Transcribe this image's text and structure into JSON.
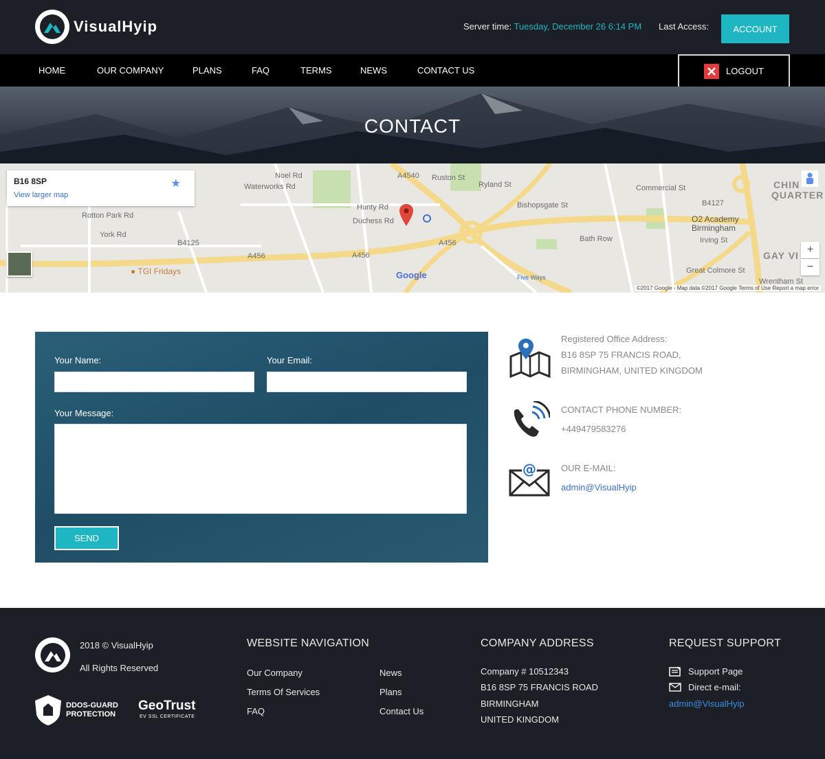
{
  "header": {
    "brand": "VisualHyip",
    "server_label": "Server time:",
    "server_time": "Tuesday, December 26 6:14 PM",
    "last_access_label": "Last Access:",
    "account_label": "ACCOUNT",
    "accent_color": "#1fb6c4"
  },
  "nav": {
    "items": [
      "HOME",
      "OUR COMPANY",
      "PLANS",
      "FAQ",
      "TERMS",
      "NEWS",
      "CONTACT US"
    ],
    "logout_label": "LOGOUT"
  },
  "hero": {
    "title": "CONTACT"
  },
  "map": {
    "postcode": "B16 8SP",
    "view_larger": "View larger map",
    "labels": [
      "Hunty Rd",
      "Duchess Rd",
      "A456",
      "A4540",
      "Bath Row",
      "Bishopsgate St",
      "O2 Academy Birmingham",
      "TGI Fridays",
      "Five Ways",
      "Commercial St",
      "Great Colmore St",
      "B4127",
      "B4125",
      "Wrentham St",
      "Irving St",
      "Ryland St",
      "Ruston St",
      "Noel Rd",
      "York Rd",
      "Rotton Park Rd",
      "Waterworks Rd"
    ],
    "districts": [
      "CHIN",
      "QUARTER",
      "GAY VI"
    ],
    "google": "Google",
    "zoom_in": "+",
    "zoom_out": "−",
    "footer": "©2017 Google - Map data ©2017 Google   Terms of Use   Report a map error"
  },
  "form": {
    "name_label": "Your Name:",
    "email_label": "Your Email:",
    "message_label": "Your Message:",
    "name_value": "",
    "email_value": "",
    "message_value": "",
    "send_label": "SEND"
  },
  "contact": {
    "office_label": "Registered Office Address:",
    "office_line1": "B16 8SP 75 FRANCIS ROAD,",
    "office_line2": "BIRMINGHAM, UNITED KINGDOM",
    "phone_label": "CONTACT PHONE NUMBER:",
    "phone": "+449479583276",
    "email_label": "OUR E-MAIL:",
    "email": "admin@VisualHyip"
  },
  "footer": {
    "copyright": "2018 © VisualHyip",
    "rights": "All Rights Reserved",
    "ddos_line1": "DDOS-GUARD",
    "ddos_line2": "PROTECTION",
    "geotrust": "GeoTrust",
    "geotrust_sub": "EV SSL CERTIFICATE",
    "nav_heading": "WEBSITE NAVIGATION",
    "nav_col1": [
      "Our Company",
      "Terms Of Services",
      "FAQ"
    ],
    "nav_col2": [
      "News",
      "Plans",
      "Contact Us"
    ],
    "address_heading": "COMPANY ADDRESS",
    "address_lines": [
      "Company # 10512343",
      "B16 8SP 75 FRANCIS ROAD",
      "BIRMINGHAM",
      "UNITED KINGDOM"
    ],
    "support_heading": "REQUEST SUPPORT",
    "support_page": "Support Page",
    "direct_email_label": "Direct e-mail:",
    "direct_email": "admin@VisualHyip"
  }
}
